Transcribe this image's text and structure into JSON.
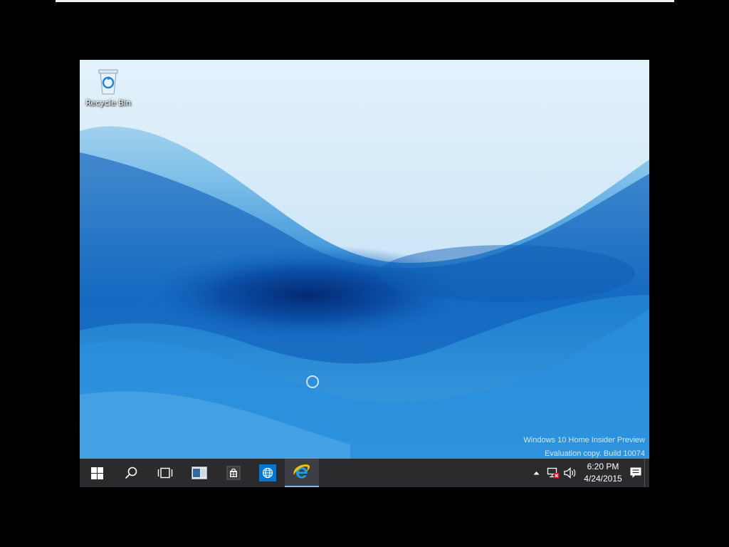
{
  "desktop": {
    "icons": [
      {
        "label": "Recycle Bin",
        "icon": "recycle-bin-icon"
      }
    ]
  },
  "watermark": {
    "line1": "Windows 10 Home Insider Preview",
    "line2": "Evaluation copy. Build 10074"
  },
  "taskbar": {
    "buttons": [
      {
        "name": "start",
        "icon": "windows-logo-icon"
      },
      {
        "name": "search",
        "icon": "search-icon"
      },
      {
        "name": "task-view",
        "icon": "task-view-icon"
      },
      {
        "name": "file-explorer",
        "icon": "file-explorer-icon"
      },
      {
        "name": "store",
        "icon": "store-icon"
      },
      {
        "name": "browser",
        "icon": "globe-icon"
      },
      {
        "name": "internet-explorer",
        "icon": "internet-explorer-icon",
        "active": true
      }
    ],
    "tray": {
      "icons": [
        "chevron-up-icon",
        "network-disconnected-icon",
        "volume-icon",
        "action-center-icon"
      ],
      "time": "6:20 PM",
      "date": "4/24/2015"
    }
  },
  "colors": {
    "taskbar": "#2b2b2d",
    "accent": "#0078d7",
    "ie_blue": "#1d9fe6",
    "ie_gold": "#f2c200",
    "network_error": "#e81123"
  }
}
